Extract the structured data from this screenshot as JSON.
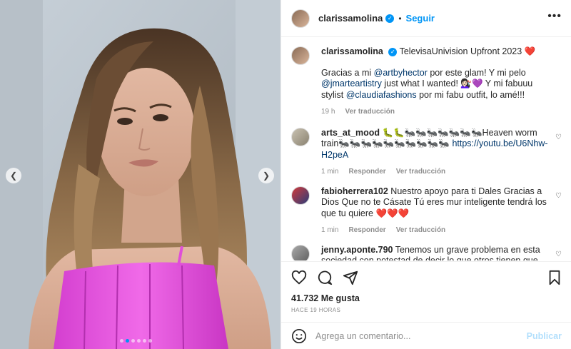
{
  "post": {
    "username": "clarissamolina",
    "follow_label": "Seguir",
    "more_label": "•••",
    "prev_icon": "chevron-left-icon",
    "next_icon": "chevron-right-icon",
    "slide_count": 6,
    "active_slide": 2
  },
  "caption": {
    "username": "clarissamolina",
    "line1": "TelevisaUnivision Upfront 2023 ❤️",
    "text_a": "Gracias a mi ",
    "mention1": "@artbyhector",
    "text_b": " por este glam! Y mi pelo ",
    "mention2": "@jmarteartistry",
    "text_c": " just what I wanted! 💇🏻‍♀️💜 Y mi fabuuu stylist ",
    "mention3": "@claudiafashions",
    "text_d": " por mi fabu outfit, lo amé!!!",
    "time": "19 h",
    "translate": "Ver traducción"
  },
  "comments": [
    {
      "username": "arts_at_mood",
      "text": "🐛🐛🐜🐜🐜🐜🐜🐜🐜Heaven worm train🐜🐜🐜🐜🐜🐜🐜🐜🐜🐜 ",
      "link": "https://youtu.be/U6Nhw-H2peA",
      "time": "1 min",
      "reply": "Responder",
      "translate": "Ver traducción"
    },
    {
      "username": "fabioherrera102",
      "text": "Nuestro apoyo para ti Dales Gracias a Dios Que no te Cásate Tú eres mur inteligente tendrá los que tu quiere ",
      "hearts": "❤️❤️❤️",
      "time": "1 min",
      "reply": "Responder",
      "translate": "Ver traducción"
    },
    {
      "username": "jenny.aponte.790",
      "text": "Tenemos un grave problema en esta sociedad con potestad de decir lo que otros tienen que hacer ,"
    }
  ],
  "actions": {
    "like_icon": "heart-icon",
    "comment_icon": "comment-icon",
    "share_icon": "send-icon",
    "save_icon": "bookmark-icon",
    "likes": "41.732 Me gusta",
    "ago": "HACE 19 HORAS"
  },
  "composer": {
    "emoji_icon": "smiley-icon",
    "placeholder": "Agrega un comentario...",
    "publish": "Publicar"
  },
  "colors": {
    "accent": "#0095f6",
    "dress": "#e04fd8",
    "hair": "#7a5a3c"
  }
}
